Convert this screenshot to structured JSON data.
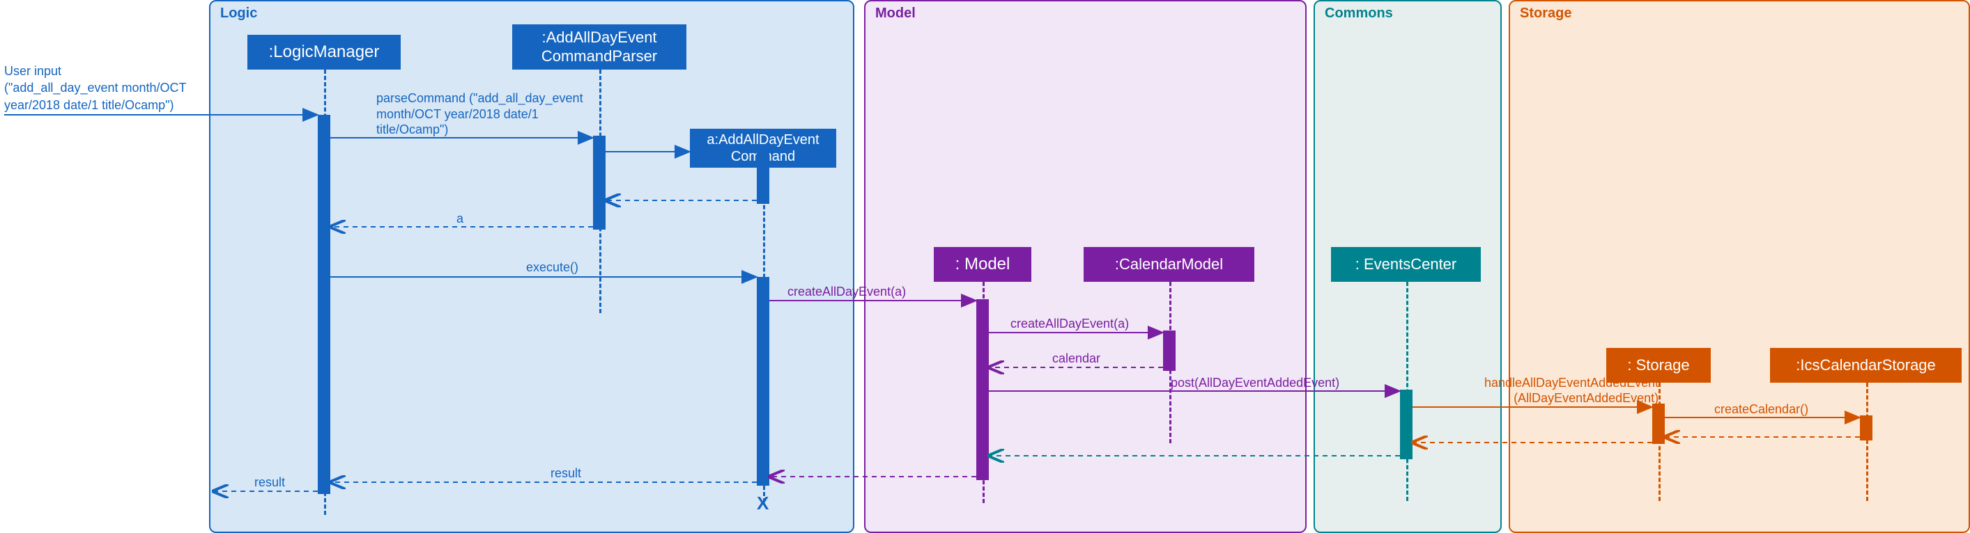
{
  "regions": {
    "logic": {
      "label": "Logic"
    },
    "model": {
      "label": "Model"
    },
    "commons": {
      "label": "Commons"
    },
    "storage": {
      "label": "Storage"
    }
  },
  "objects": {
    "logicManager": ":LogicManager",
    "addAllDayParser": ":AddAllDayEvent\nCommandParser",
    "addAllDayCmd": "a:AddAllDayEvent\nCommand",
    "model": ": Model",
    "calendarModel": ":CalendarModel",
    "eventsCenter": ": EventsCenter",
    "storage": ": Storage",
    "icsCalendarStorage": ":IcsCalendarStorage"
  },
  "messages": {
    "userInput": "User input\n(\"add_all_day_event month/OCT\nyear/2018 date/1 title/Ocamp\")",
    "parseCommand": "parseCommand (\"add_all_day_event\nmonth/OCT year/2018 date/1\ntitle/Ocamp\")",
    "returnA": "a",
    "execute": "execute()",
    "createAllDayEvent_a": "createAllDayEvent(a)",
    "createAllDayEvent_a2": "createAllDayEvent(a)",
    "calendar": "calendar",
    "postEvent": "post(AllDayEventAddedEvent)",
    "handleEvent": "handleAllDayEventAddedEvent\n(AllDayEventAddedEvent)",
    "createCalendar": "createCalendar()",
    "resultInner": "result",
    "resultOuter": "result",
    "resultToActor": "result"
  },
  "colors": {
    "blue": "#1565C0",
    "purple": "#7B1FA2",
    "teal": "#00838F",
    "orange": "#D35400",
    "logicFill": "#D8E7F5",
    "modelFill": "#F1E7F6",
    "commonsFill": "#E6EFEE",
    "storageFill": "#FBE8D6"
  }
}
